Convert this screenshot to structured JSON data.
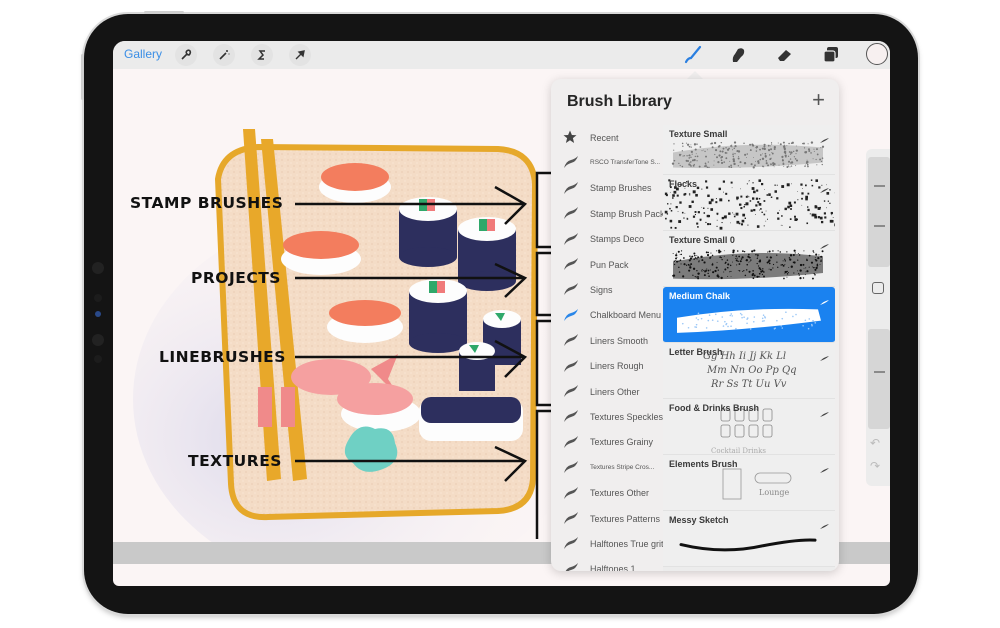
{
  "toolbar": {
    "gallery_label": "Gallery",
    "left_tools": [
      {
        "name": "actions",
        "icon": "wrench-icon",
        "glyph": "⚒"
      },
      {
        "name": "adjustments",
        "icon": "magic-wand-icon",
        "glyph": "✧"
      },
      {
        "name": "selection",
        "icon": "selection-s-icon",
        "glyph": "S"
      },
      {
        "name": "transform",
        "icon": "arrow-cursor-icon",
        "glyph": "➚"
      }
    ],
    "right_tools": [
      {
        "name": "brush",
        "icon": "brush-icon",
        "active": true
      },
      {
        "name": "smudge",
        "icon": "smudge-finger-icon",
        "active": false
      },
      {
        "name": "eraser",
        "icon": "eraser-icon",
        "active": false
      },
      {
        "name": "layers",
        "icon": "layers-icon",
        "active": false
      }
    ],
    "active_color": "#f7f0f0",
    "accent_color": "#3a8ee6"
  },
  "annotations": [
    {
      "label": "STAMP BRUSHES"
    },
    {
      "label": "PROJECTS"
    },
    {
      "label": "LINEBRUSHES"
    },
    {
      "label": "TEXTURES"
    }
  ],
  "brush_library": {
    "title": "Brush Library",
    "add_icon": "+",
    "sets": [
      {
        "label": "Recent",
        "icon": "star-icon",
        "selected": false
      },
      {
        "label": "RSCO TransferTone S...",
        "icon": "brush-stroke-icon",
        "selected": false,
        "small": true
      },
      {
        "label": "Stamp Brushes",
        "icon": "brush-stroke-icon",
        "selected": false
      },
      {
        "label": "Stamp Brush Pack",
        "icon": "brush-stroke-icon",
        "selected": false
      },
      {
        "label": "Stamps Deco",
        "icon": "brush-stroke-icon",
        "selected": false
      },
      {
        "label": "Pun Pack",
        "icon": "brush-stroke-icon",
        "selected": false
      },
      {
        "label": "Signs",
        "icon": "brush-stroke-icon",
        "selected": false
      },
      {
        "label": "Chalkboard Menu",
        "icon": "brush-stroke-icon",
        "selected": true
      },
      {
        "label": "Liners Smooth",
        "icon": "brush-stroke-icon",
        "selected": false
      },
      {
        "label": "Liners Rough",
        "icon": "brush-stroke-icon",
        "selected": false
      },
      {
        "label": "Liners Other",
        "icon": "brush-stroke-icon",
        "selected": false
      },
      {
        "label": "Textures Speckles",
        "icon": "brush-stroke-icon",
        "selected": false
      },
      {
        "label": "Textures Grainy",
        "icon": "brush-stroke-icon",
        "selected": false
      },
      {
        "label": "Textures Stripe Cros...",
        "icon": "brush-stroke-icon",
        "selected": false,
        "small": true
      },
      {
        "label": "Textures Other",
        "icon": "brush-stroke-icon",
        "selected": false
      },
      {
        "label": "Textures Patterns",
        "icon": "brush-stroke-icon",
        "selected": false
      },
      {
        "label": "Halftones True grit",
        "icon": "brush-stroke-icon",
        "selected": false
      },
      {
        "label": "Halftones 1",
        "icon": "brush-stroke-icon",
        "selected": false
      }
    ],
    "brushes": [
      {
        "name": "Texture Small",
        "preview": "grainy-light",
        "selected": false
      },
      {
        "name": "Flecks",
        "preview": "flecks",
        "selected": false
      },
      {
        "name": "Texture Small 0",
        "preview": "grainy-dark",
        "selected": false
      },
      {
        "name": "Medium Chalk",
        "preview": "chalk-white",
        "selected": true
      },
      {
        "name": "Letter Brush",
        "preview": "script-letters",
        "preview_text": "Gg Hh Ii Jj Kk Ll  Mm Nn Oo Pp Qq  Rr Ss Tt Uu Vv",
        "selected": false
      },
      {
        "name": "Food & Drinks Brush",
        "preview": "food-stamps",
        "selected": false
      },
      {
        "name": "Elements Brush",
        "preview": "element-stamps",
        "preview_text": "Lounge",
        "selected": false
      },
      {
        "name": "Messy Sketch",
        "preview": "ink-stroke",
        "selected": false
      }
    ]
  },
  "side_controls": {
    "brush_size_slider": {
      "label": "Brush size",
      "value": 0.35
    },
    "opacity_slider": {
      "label": "Opacity",
      "value": 0.3
    },
    "undo_icon": "↶",
    "redo_icon": "↷"
  }
}
